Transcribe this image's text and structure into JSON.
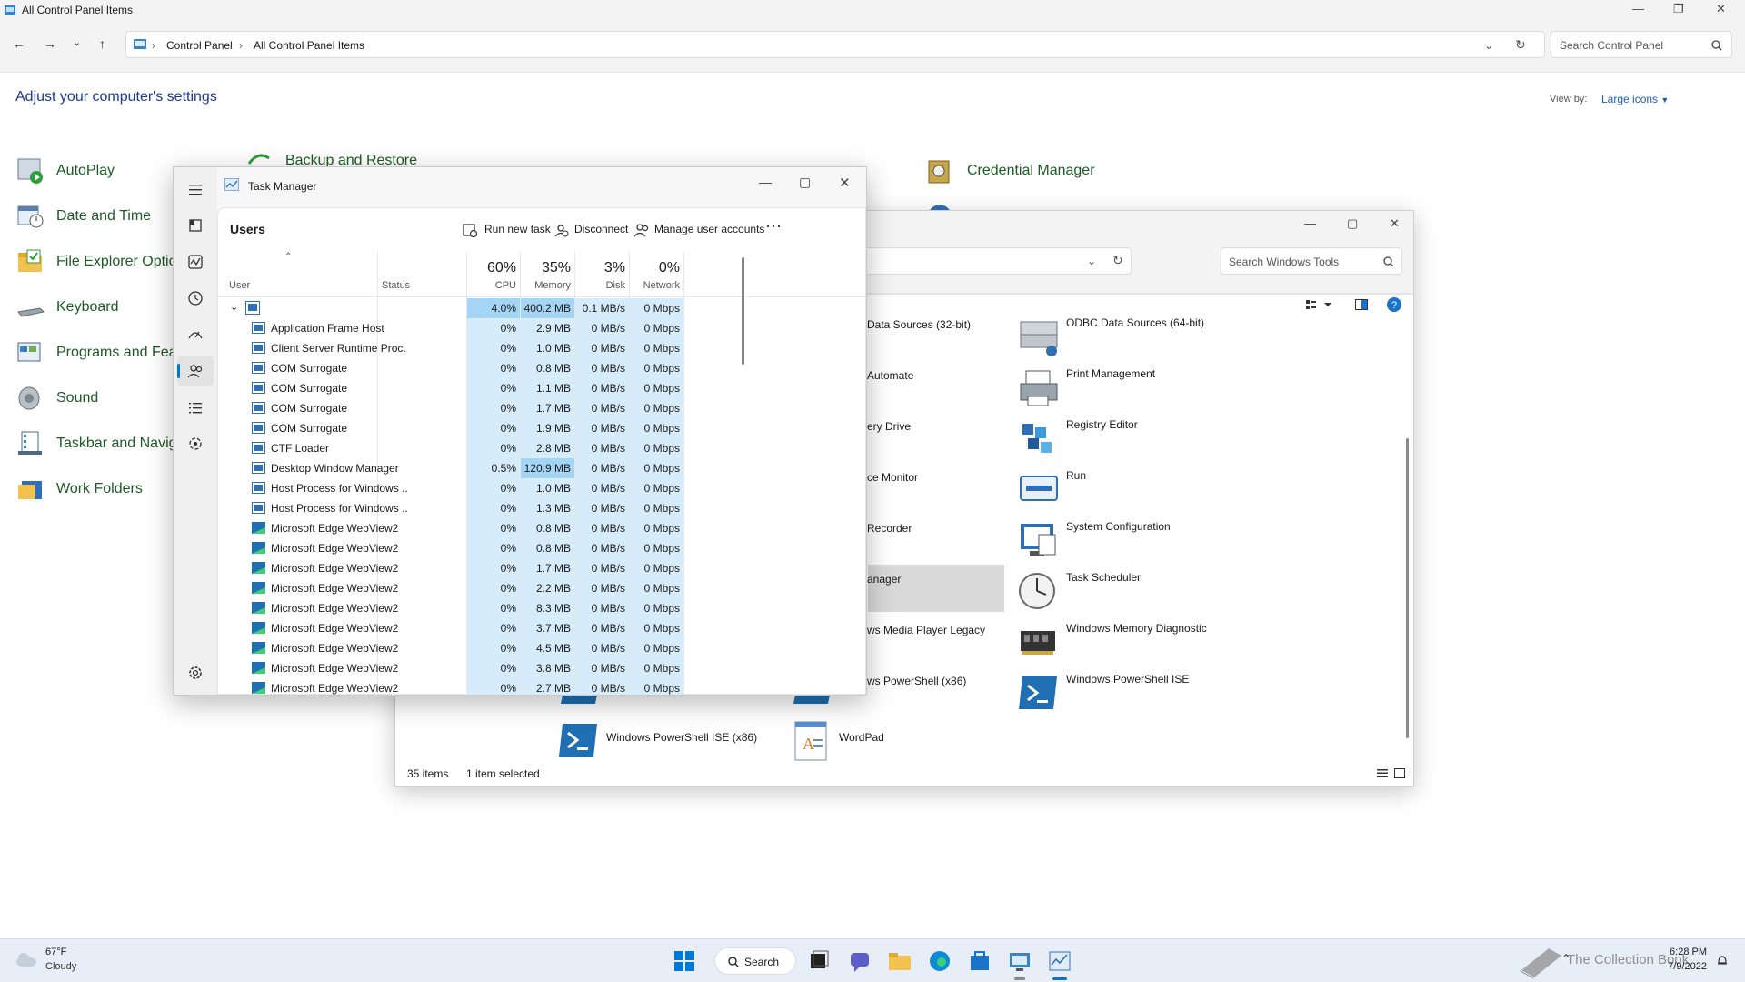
{
  "cp": {
    "title": "All Control Panel Items",
    "breadcrumb": [
      "Control Panel",
      "All Control Panel Items"
    ],
    "search_placeholder": "Search Control Panel",
    "heading": "Adjust your computer's settings",
    "view_by_label": "View by:",
    "view_by_value": "Large icons",
    "items": [
      "AutoPlay",
      "Date and Time",
      "File Explorer Optio",
      "Keyboard",
      "Programs and Feat",
      "Sound",
      "Taskbar and Navig",
      "Work Folders",
      "Backup and Restore",
      "Credential Manager"
    ]
  },
  "wt": {
    "search_placeholder": "Search Windows Tools",
    "left_items": [
      "Data Sources (32-bit)",
      "Automate",
      "ery Drive",
      "ce Monitor",
      "Recorder",
      "anager",
      "ws Media Player Legacy",
      "ws PowerShell (x86)",
      "Windows PowerShell ISE (x86)",
      "WordPad"
    ],
    "right_items": [
      "ODBC Data Sources (64-bit)",
      "Print Management",
      "Registry Editor",
      "Run",
      "System Configuration",
      "Task Scheduler",
      "Windows Memory Diagnostic",
      "Windows PowerShell ISE"
    ],
    "status_items": "35 items",
    "status_selected": "1 item selected"
  },
  "tm": {
    "title": "Task Manager",
    "page": "Users",
    "cmd_run": "Run new task",
    "cmd_disconnect": "Disconnect",
    "cmd_manage": "Manage user accounts",
    "col_user": "User",
    "col_status": "Status",
    "cpu_pct": "60%",
    "cpu_label": "CPU",
    "mem_pct": "35%",
    "mem_label": "Memory",
    "disk_pct": "3%",
    "disk_label": "Disk",
    "net_pct": "0%",
    "net_label": "Network",
    "group": {
      "cpu": "4.0%",
      "mem": "400.2 MB",
      "disk": "0.1 MB/s",
      "net": "0 Mbps"
    },
    "rows": [
      {
        "name": "Application Frame Host",
        "cpu": "0%",
        "mem": "2.9 MB",
        "disk": "0 MB/s",
        "net": "0 Mbps"
      },
      {
        "name": "Client Server Runtime Proc...",
        "cpu": "0%",
        "mem": "1.0 MB",
        "disk": "0 MB/s",
        "net": "0 Mbps"
      },
      {
        "name": "COM Surrogate",
        "cpu": "0%",
        "mem": "0.8 MB",
        "disk": "0 MB/s",
        "net": "0 Mbps"
      },
      {
        "name": "COM Surrogate",
        "cpu": "0%",
        "mem": "1.1 MB",
        "disk": "0 MB/s",
        "net": "0 Mbps"
      },
      {
        "name": "COM Surrogate",
        "cpu": "0%",
        "mem": "1.7 MB",
        "disk": "0 MB/s",
        "net": "0 Mbps"
      },
      {
        "name": "COM Surrogate",
        "cpu": "0%",
        "mem": "1.9 MB",
        "disk": "0 MB/s",
        "net": "0 Mbps"
      },
      {
        "name": "CTF Loader",
        "cpu": "0%",
        "mem": "2.8 MB",
        "disk": "0 MB/s",
        "net": "0 Mbps"
      },
      {
        "name": "Desktop Window Manager",
        "cpu": "0.5%",
        "mem": "120.9 MB",
        "disk": "0 MB/s",
        "net": "0 Mbps"
      },
      {
        "name": "Host Process for Windows ...",
        "cpu": "0%",
        "mem": "1.0 MB",
        "disk": "0 MB/s",
        "net": "0 Mbps"
      },
      {
        "name": "Host Process for Windows ...",
        "cpu": "0%",
        "mem": "1.3 MB",
        "disk": "0 MB/s",
        "net": "0 Mbps"
      },
      {
        "name": "Microsoft Edge WebView2",
        "cpu": "0%",
        "mem": "0.8 MB",
        "disk": "0 MB/s",
        "net": "0 Mbps"
      },
      {
        "name": "Microsoft Edge WebView2",
        "cpu": "0%",
        "mem": "0.8 MB",
        "disk": "0 MB/s",
        "net": "0 Mbps"
      },
      {
        "name": "Microsoft Edge WebView2",
        "cpu": "0%",
        "mem": "1.7 MB",
        "disk": "0 MB/s",
        "net": "0 Mbps"
      },
      {
        "name": "Microsoft Edge WebView2",
        "cpu": "0%",
        "mem": "2.2 MB",
        "disk": "0 MB/s",
        "net": "0 Mbps"
      },
      {
        "name": "Microsoft Edge WebView2",
        "cpu": "0%",
        "mem": "8.3 MB",
        "disk": "0 MB/s",
        "net": "0 Mbps"
      },
      {
        "name": "Microsoft Edge WebView2",
        "cpu": "0%",
        "mem": "3.7 MB",
        "disk": "0 MB/s",
        "net": "0 Mbps"
      },
      {
        "name": "Microsoft Edge WebView2",
        "cpu": "0%",
        "mem": "4.5 MB",
        "disk": "0 MB/s",
        "net": "0 Mbps"
      },
      {
        "name": "Microsoft Edge WebView2",
        "cpu": "0%",
        "mem": "3.8 MB",
        "disk": "0 MB/s",
        "net": "0 Mbps"
      },
      {
        "name": "Microsoft Edge WebView2",
        "cpu": "0%",
        "mem": "2.7 MB",
        "disk": "0 MB/s",
        "net": "0 Mbps"
      }
    ]
  },
  "taskbar": {
    "temp": "67°F",
    "weather": "Cloudy",
    "search": "Search",
    "time": "6:28 PM",
    "date": "7/9/2022",
    "watermark": "The Collection Book"
  },
  "colors": {
    "accent": "#0078d4",
    "heat_light": "#d6ecfb",
    "heat_mid": "#bfe1f8",
    "heat_strong": "#a5d5f5"
  }
}
